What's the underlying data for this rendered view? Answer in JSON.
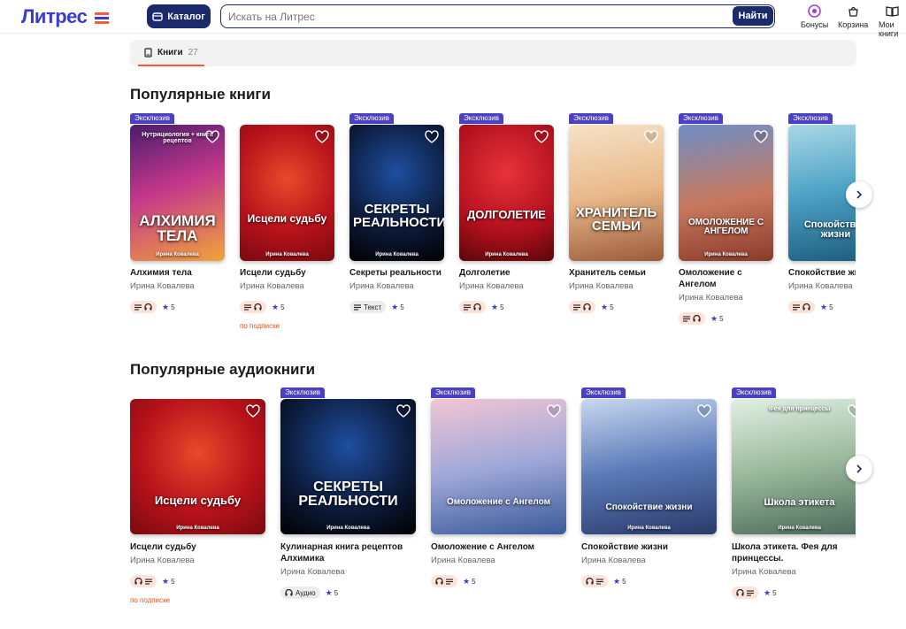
{
  "header": {
    "logo": "Литрес",
    "catalog_label": "Каталог",
    "search_placeholder": "Искать на Литрес",
    "search_button": "Найти",
    "bonuses": "Бонусы",
    "cart": "Корзина",
    "my_books": "Мои книги"
  },
  "tabs": [
    {
      "label": "Книги",
      "count": "27"
    }
  ],
  "sections": {
    "books_title": "Популярные книги",
    "audio_title": "Популярные аудиокниги"
  },
  "badge_text": "Эксклюзив",
  "subscription_text": "по подписке",
  "text_chip": "Текст",
  "audio_chip": "Аудио",
  "books": [
    {
      "title": "Алхимия тела",
      "author": "Ирина Ковалева",
      "rating": "5",
      "cover_title": "АЛХИМИЯ ТЕЛА",
      "cover_sub": "Нутрициология + книга рецептов",
      "cover_author": "Ирина Ковалева"
    },
    {
      "title": "Исцели судьбу",
      "author": "Ирина Ковалева",
      "rating": "5",
      "cover_title": "Исцели судьбу",
      "cover_author": "Ирина Ковалева"
    },
    {
      "title": "Секреты реальности",
      "author": "Ирина Ковалева",
      "rating": "5",
      "cover_title": "СЕКРЕТЫ РЕАЛЬНОСТИ",
      "cover_author": "Ирина Ковалева"
    },
    {
      "title": "Долголетие",
      "author": "Ирина Ковалева",
      "rating": "5",
      "cover_title": "ДОЛГОЛЕТИЕ",
      "cover_author": "Ирина Ковалева"
    },
    {
      "title": "Хранитель семьи",
      "author": "Ирина Ковалева",
      "rating": "5",
      "cover_title": "ХРАНИТЕЛЬ СЕМЬИ"
    },
    {
      "title": "Омоложение с Ангелом",
      "author": "Ирина Ковалева",
      "rating": "5",
      "cover_title": "ОМОЛОЖЕНИЕ С АНГЕЛОМ",
      "cover_author": "Ирина Ковалева"
    },
    {
      "title": "Спокойствие жизни",
      "author": "Ирина Ковалева",
      "rating": "5",
      "cover_title": "Спокойствие жизни"
    }
  ],
  "audiobooks": [
    {
      "title": "Исцели судьбу",
      "author": "Ирина Ковалева",
      "rating": "5",
      "cover_title": "Исцели судьбу",
      "cover_author": "Ирина Ковалева"
    },
    {
      "title": "Кулинарная книга рецептов Алхимика",
      "author": "Ирина Ковалева",
      "rating": "5",
      "cover_title": "СЕКРЕТЫ РЕАЛЬНОСТИ",
      "cover_author": "Ирина Ковалева"
    },
    {
      "title": "Омоложение с Ангелом",
      "author": "Ирина Ковалева",
      "rating": "5",
      "cover_title": "Омоложение с Ангелом"
    },
    {
      "title": "Спокойствие жизни",
      "author": "Ирина Ковалева",
      "rating": "5",
      "cover_title": "Спокойствие жизни",
      "cover_author": "Ирина Ковалева"
    },
    {
      "title": "Школа этикета. Фея для принцессы.",
      "author": "Ирина Ковалева",
      "rating": "5",
      "cover_title": "Школа этикета",
      "cover_sub": "Фея для принцессы",
      "cover_author": "Ирина Ковалева"
    }
  ],
  "colors": {
    "brand": "#3a3ad6",
    "accent": "#ff5a36",
    "navy": "#1b2a6b",
    "badge": "#4b3fc4"
  }
}
